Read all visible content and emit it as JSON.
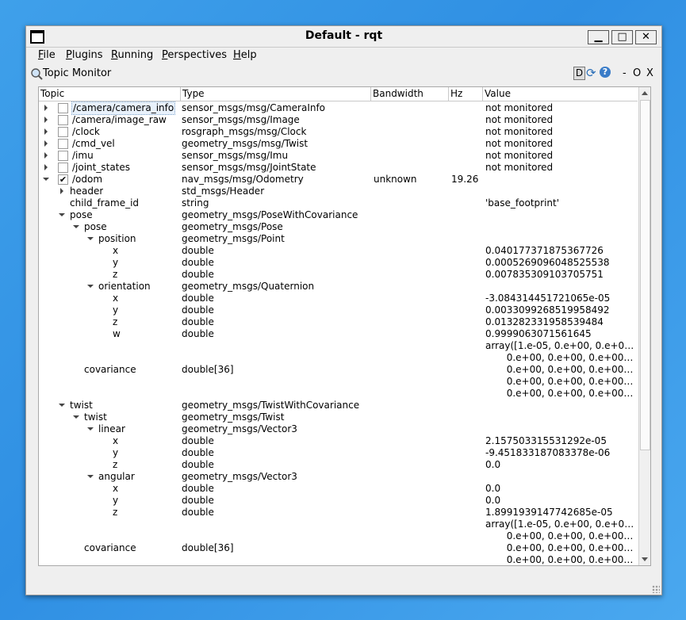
{
  "window": {
    "title": "Default - rqt",
    "min_label": "▁",
    "max_label": "□",
    "close_label": "✕"
  },
  "menu": [
    {
      "label": "File",
      "key": "F"
    },
    {
      "label": "Plugins",
      "key": "P"
    },
    {
      "label": "Running",
      "key": "R"
    },
    {
      "label": "Perspectives",
      "key": "P"
    },
    {
      "label": "Help",
      "key": "H"
    }
  ],
  "plugin": {
    "title": "Topic Monitor",
    "controls": {
      "d": "D",
      "refresh": "⟳",
      "help": "?",
      "minimize": "-",
      "float": "O",
      "close": "X"
    }
  },
  "columns": [
    "Topic",
    "Type",
    "Bandwidth",
    "Hz",
    "Value"
  ],
  "rows": [
    {
      "topic": "/camera/camera_info",
      "type": "sensor_msgs/msg/CameraInfo",
      "bw": "",
      "hz": "",
      "value": "not monitored",
      "depth": 0,
      "arrow": "collapsed",
      "check": "unchecked",
      "selected": true
    },
    {
      "topic": "/camera/image_raw",
      "type": "sensor_msgs/msg/Image",
      "bw": "",
      "hz": "",
      "value": "not monitored",
      "depth": 0,
      "arrow": "collapsed",
      "check": "unchecked"
    },
    {
      "topic": "/clock",
      "type": "rosgraph_msgs/msg/Clock",
      "bw": "",
      "hz": "",
      "value": "not monitored",
      "depth": 0,
      "arrow": "collapsed",
      "check": "unchecked"
    },
    {
      "topic": "/cmd_vel",
      "type": "geometry_msgs/msg/Twist",
      "bw": "",
      "hz": "",
      "value": "not monitored",
      "depth": 0,
      "arrow": "collapsed",
      "check": "unchecked"
    },
    {
      "topic": "/imu",
      "type": "sensor_msgs/msg/Imu",
      "bw": "",
      "hz": "",
      "value": "not monitored",
      "depth": 0,
      "arrow": "collapsed",
      "check": "unchecked"
    },
    {
      "topic": "/joint_states",
      "type": "sensor_msgs/msg/JointState",
      "bw": "",
      "hz": "",
      "value": "not monitored",
      "depth": 0,
      "arrow": "collapsed",
      "check": "unchecked"
    },
    {
      "topic": "/odom",
      "type": "nav_msgs/msg/Odometry",
      "bw": "unknown",
      "hz": "19.26",
      "value": "",
      "depth": 0,
      "arrow": "expanded",
      "check": "checked"
    },
    {
      "topic": "header",
      "type": "std_msgs/Header",
      "bw": "",
      "hz": "",
      "value": "",
      "depth": 1,
      "arrow": "collapsed"
    },
    {
      "topic": "child_frame_id",
      "type": "string",
      "bw": "",
      "hz": "",
      "value": "'base_footprint'",
      "depth": 1,
      "arrow": "none"
    },
    {
      "topic": "pose",
      "type": "geometry_msgs/PoseWithCovariance",
      "bw": "",
      "hz": "",
      "value": "",
      "depth": 1,
      "arrow": "expanded"
    },
    {
      "topic": "pose",
      "type": "geometry_msgs/Pose",
      "bw": "",
      "hz": "",
      "value": "",
      "depth": 2,
      "arrow": "expanded"
    },
    {
      "topic": "position",
      "type": "geometry_msgs/Point",
      "bw": "",
      "hz": "",
      "value": "",
      "depth": 3,
      "arrow": "expanded"
    },
    {
      "topic": "x",
      "type": "double",
      "bw": "",
      "hz": "",
      "value": "0.040177371875367726",
      "depth": 4,
      "arrow": "none"
    },
    {
      "topic": "y",
      "type": "double",
      "bw": "",
      "hz": "",
      "value": "0.0005269096048525538",
      "depth": 4,
      "arrow": "none"
    },
    {
      "topic": "z",
      "type": "double",
      "bw": "",
      "hz": "",
      "value": "0.007835309103705751",
      "depth": 4,
      "arrow": "none"
    },
    {
      "topic": "orientation",
      "type": "geometry_msgs/Quaternion",
      "bw": "",
      "hz": "",
      "value": "",
      "depth": 3,
      "arrow": "expanded"
    },
    {
      "topic": "x",
      "type": "double",
      "bw": "",
      "hz": "",
      "value": "-3.084314451721065e-05",
      "depth": 4,
      "arrow": "none"
    },
    {
      "topic": "y",
      "type": "double",
      "bw": "",
      "hz": "",
      "value": "0.0033099268519958492",
      "depth": 4,
      "arrow": "none"
    },
    {
      "topic": "z",
      "type": "double",
      "bw": "",
      "hz": "",
      "value": "0.013282331958539484",
      "depth": 4,
      "arrow": "none"
    },
    {
      "topic": "w",
      "type": "double",
      "bw": "",
      "hz": "",
      "value": "0.9999063071561645",
      "depth": 4,
      "arrow": "none"
    },
    {
      "topic": "",
      "type": "",
      "bw": "",
      "hz": "",
      "value": "array([1.e-05, 0.e+00, 0.e+0…",
      "depth": 2,
      "arrow": "none"
    },
    {
      "topic": "",
      "type": "",
      "bw": "",
      "hz": "",
      "value": "       0.e+00, 0.e+00, 0.e+00…",
      "depth": 2,
      "arrow": "none"
    },
    {
      "topic": "covariance",
      "type": "double[36]",
      "bw": "",
      "hz": "",
      "value": "       0.e+00, 0.e+00, 0.e+00…",
      "depth": 2,
      "arrow": "none"
    },
    {
      "topic": "",
      "type": "",
      "bw": "",
      "hz": "",
      "value": "       0.e+00, 0.e+00, 0.e+00…",
      "depth": 2,
      "arrow": "none"
    },
    {
      "topic": "",
      "type": "",
      "bw": "",
      "hz": "",
      "value": "       0.e+00, 0.e+00, 0.e+00…",
      "depth": 2,
      "arrow": "none"
    },
    {
      "topic": "twist",
      "type": "geometry_msgs/TwistWithCovariance",
      "bw": "",
      "hz": "",
      "value": "",
      "depth": 1,
      "arrow": "expanded"
    },
    {
      "topic": "twist",
      "type": "geometry_msgs/Twist",
      "bw": "",
      "hz": "",
      "value": "",
      "depth": 2,
      "arrow": "expanded"
    },
    {
      "topic": "linear",
      "type": "geometry_msgs/Vector3",
      "bw": "",
      "hz": "",
      "value": "",
      "depth": 3,
      "arrow": "expanded"
    },
    {
      "topic": "x",
      "type": "double",
      "bw": "",
      "hz": "",
      "value": "2.157503315531292e-05",
      "depth": 4,
      "arrow": "none"
    },
    {
      "topic": "y",
      "type": "double",
      "bw": "",
      "hz": "",
      "value": "-9.451833187083378e-06",
      "depth": 4,
      "arrow": "none"
    },
    {
      "topic": "z",
      "type": "double",
      "bw": "",
      "hz": "",
      "value": "0.0",
      "depth": 4,
      "arrow": "none"
    },
    {
      "topic": "angular",
      "type": "geometry_msgs/Vector3",
      "bw": "",
      "hz": "",
      "value": "",
      "depth": 3,
      "arrow": "expanded"
    },
    {
      "topic": "x",
      "type": "double",
      "bw": "",
      "hz": "",
      "value": "0.0",
      "depth": 4,
      "arrow": "none"
    },
    {
      "topic": "y",
      "type": "double",
      "bw": "",
      "hz": "",
      "value": "0.0",
      "depth": 4,
      "arrow": "none"
    },
    {
      "topic": "z",
      "type": "double",
      "bw": "",
      "hz": "",
      "value": "1.8991939147742685e-05",
      "depth": 4,
      "arrow": "none"
    },
    {
      "topic": "",
      "type": "",
      "bw": "",
      "hz": "",
      "value": "array([1.e-05, 0.e+00, 0.e+0…",
      "depth": 2,
      "arrow": "none"
    },
    {
      "topic": "",
      "type": "",
      "bw": "",
      "hz": "",
      "value": "       0.e+00, 0.e+00, 0.e+00…",
      "depth": 2,
      "arrow": "none"
    },
    {
      "topic": "covariance",
      "type": "double[36]",
      "bw": "",
      "hz": "",
      "value": "       0.e+00, 0.e+00, 0.e+00…",
      "depth": 2,
      "arrow": "none"
    },
    {
      "topic": "",
      "type": "",
      "bw": "",
      "hz": "",
      "value": "       0.e+00, 0.e+00, 0.e+00…",
      "depth": 2,
      "arrow": "none"
    }
  ]
}
